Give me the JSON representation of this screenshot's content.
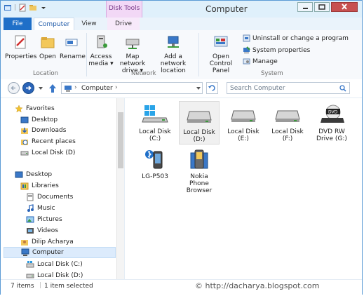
{
  "window": {
    "title": "Computer",
    "context_tab_label": "Disk Tools"
  },
  "tabs": [
    "File",
    "Computer",
    "View",
    "Drive"
  ],
  "ribbon": {
    "location_buttons": [
      "Properties",
      "Open",
      "Rename"
    ],
    "network_buttons": [
      [
        "Access",
        "media ▾"
      ],
      [
        "Map network",
        "drive ▾"
      ],
      [
        "Add a network",
        "location"
      ]
    ],
    "system_big_button": [
      "Open Control",
      "Panel"
    ],
    "system_small_buttons": [
      "Uninstall or change a program",
      "System properties",
      "Manage"
    ],
    "groups": [
      "Location",
      "Network",
      "System"
    ]
  },
  "address": {
    "path": "Computer",
    "search_placeholder": "Search Computer"
  },
  "navpane": [
    {
      "label": "Favorites",
      "icon": "star-icon"
    },
    {
      "label": "Desktop",
      "icon": "desktop-icon"
    },
    {
      "label": "Downloads",
      "icon": "downloads-icon"
    },
    {
      "label": "Recent places",
      "icon": "recent-places-icon"
    },
    {
      "label": "Local Disk (D)",
      "icon": "disk-icon"
    },
    {
      "label": "Desktop",
      "icon": "desktop-icon"
    },
    {
      "label": "Libraries",
      "icon": "libraries-icon"
    },
    {
      "label": "Documents",
      "icon": "documents-icon"
    },
    {
      "label": "Music",
      "icon": "music-icon"
    },
    {
      "label": "Pictures",
      "icon": "pictures-icon"
    },
    {
      "label": "Videos",
      "icon": "videos-icon"
    },
    {
      "label": "Dilip Acharya",
      "icon": "user-icon"
    },
    {
      "label": "Computer",
      "icon": "computer-icon"
    },
    {
      "label": "Local Disk (C:)",
      "icon": "windows-disk-icon"
    },
    {
      "label": "Local Disk (D:)",
      "icon": "disk-icon"
    }
  ],
  "items": [
    {
      "label": "Local Disk\n(C:)",
      "icon": "windows-disk-icon"
    },
    {
      "label": "Local Disk\n(D:)",
      "icon": "hard-disk-icon"
    },
    {
      "label": "Local Disk\n(E:)",
      "icon": "hard-disk-icon"
    },
    {
      "label": "Local Disk\n(F:)",
      "icon": "hard-disk-icon"
    },
    {
      "label": "DVD RW\nDrive (G:)",
      "icon": "dvd-drive-icon"
    },
    {
      "label": "LG-P503",
      "icon": "bluetooth-phone-icon"
    },
    {
      "label": "Nokia\nPhone\nBrowser",
      "icon": "phone-browser-icon"
    }
  ],
  "status": {
    "count": "7 items",
    "selection": "1 item selected"
  },
  "watermark": "© http://dacharya.blogspot.com"
}
